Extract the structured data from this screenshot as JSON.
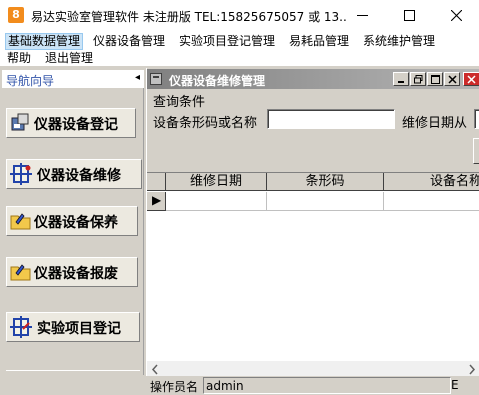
{
  "window": {
    "app_icon_glyph": "8",
    "title": "易达实验室管理软件 未注册版 TEL:15825675057 或 13...",
    "controls": [
      "minimize",
      "maximize",
      "close"
    ]
  },
  "menu": {
    "items": [
      "基础数据管理",
      "仪器设备管理",
      "实验项目登记管理",
      "易耗品管理",
      "系统维护管理",
      "帮助",
      "退出管理"
    ],
    "active_index": 0
  },
  "nav": {
    "title": "导航向导",
    "collapse_glyph": "◂",
    "buttons": [
      {
        "label": "仪器设备登记",
        "icon": "register-icon"
      },
      {
        "label": "仪器设备维修",
        "icon": "repair-icon"
      },
      {
        "label": "仪器设备保养",
        "icon": "maintain-folder-icon"
      },
      {
        "label": "仪器设备报废",
        "icon": "scrap-folder-icon"
      },
      {
        "label": "实验项目登记",
        "icon": "project-register-icon"
      }
    ]
  },
  "child": {
    "title": "仪器设备维修管理",
    "group_label": "查询条件",
    "barcode_label": "设备条形码或名称",
    "barcode_value": "",
    "date_label": "维修日期从",
    "grid": {
      "columns": [
        "维修日期",
        "条形码",
        "设备名称"
      ],
      "current_row_marker": "▶"
    }
  },
  "status": {
    "operator_label": "操作员名",
    "operator_value": "admin",
    "edge_text": "E"
  },
  "colors": {
    "client_bg": "#d4d0c8",
    "nav_title": "#3355aa",
    "child_title_gradient_start": "#808080",
    "menu_active_bg": "#cce4f7",
    "close_button_red": "#cc2a2a"
  }
}
